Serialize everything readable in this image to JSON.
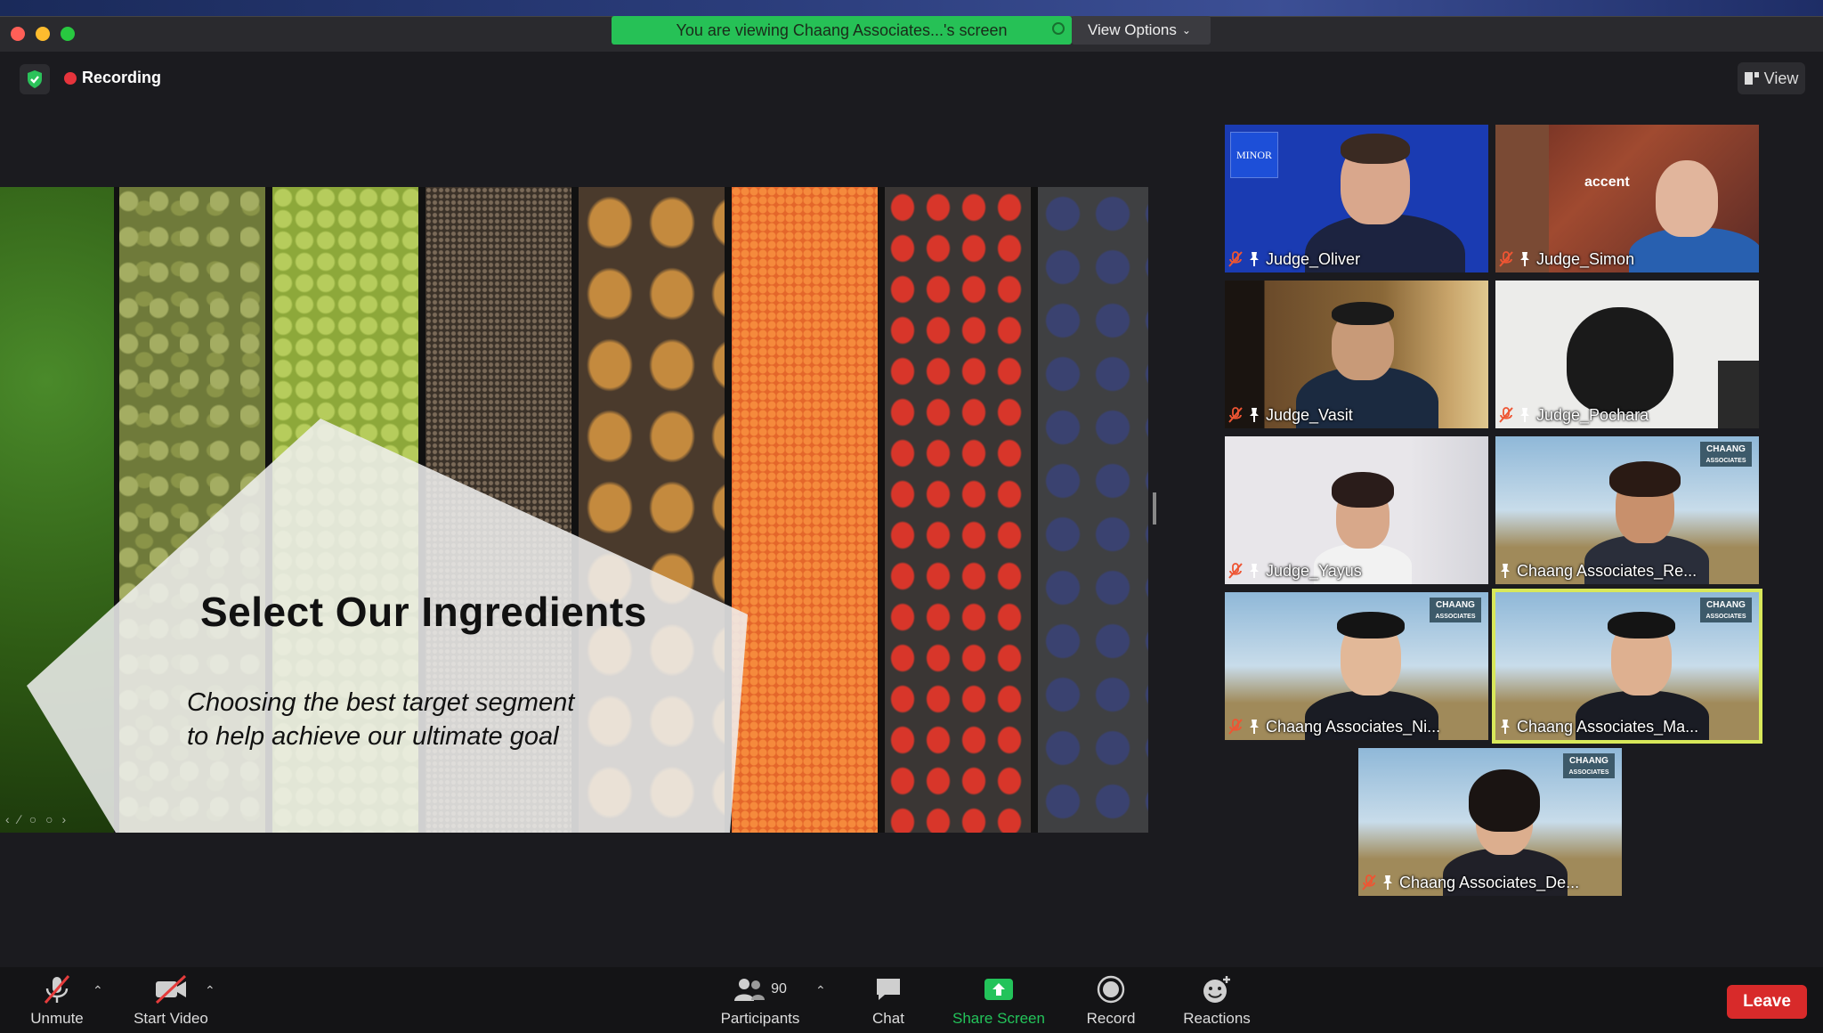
{
  "window": {
    "share_banner": "You are viewing Chaang Associates...'s screen",
    "view_options": "View Options"
  },
  "meeting": {
    "recording_label": "Recording",
    "view_label": "View"
  },
  "slide": {
    "title": "Select Our Ingredients",
    "subtitle_line1": "Choosing the best target segment",
    "subtitle_line2": "to help achieve our ultimate goal"
  },
  "participants": [
    {
      "name": "Judge_Oliver",
      "muted": true,
      "active": false
    },
    {
      "name": "Judge_Simon",
      "muted": true,
      "active": false
    },
    {
      "name": "Judge_Vasit",
      "muted": true,
      "active": false
    },
    {
      "name": "Judge_Pochara",
      "muted": true,
      "active": false
    },
    {
      "name": "Judge_Yayus",
      "muted": true,
      "active": false
    },
    {
      "name": "Chaang Associates_Re...",
      "muted": false,
      "active": false
    },
    {
      "name": "Chaang Associates_Ni...",
      "muted": true,
      "active": false
    },
    {
      "name": "Chaang Associates_Ma...",
      "muted": false,
      "active": true
    },
    {
      "name": "Chaang Associates_De...",
      "muted": true,
      "active": false
    }
  ],
  "tile_logos": {
    "minor": "MINOR",
    "chaang_line1": "CHAANG",
    "chaang_line2": "ASSOCIATES",
    "accenture": "accent"
  },
  "toolbar": {
    "unmute": "Unmute",
    "start_video": "Start Video",
    "participants": "Participants",
    "participants_count": "90",
    "chat": "Chat",
    "share_screen": "Share Screen",
    "record": "Record",
    "reactions": "Reactions",
    "leave": "Leave"
  },
  "colors": {
    "banner_green": "#26c156",
    "share_green": "#23c35a",
    "leave_red": "#d82a2a",
    "active_speaker": "#d8e85a",
    "recording_red": "#e6343c"
  }
}
